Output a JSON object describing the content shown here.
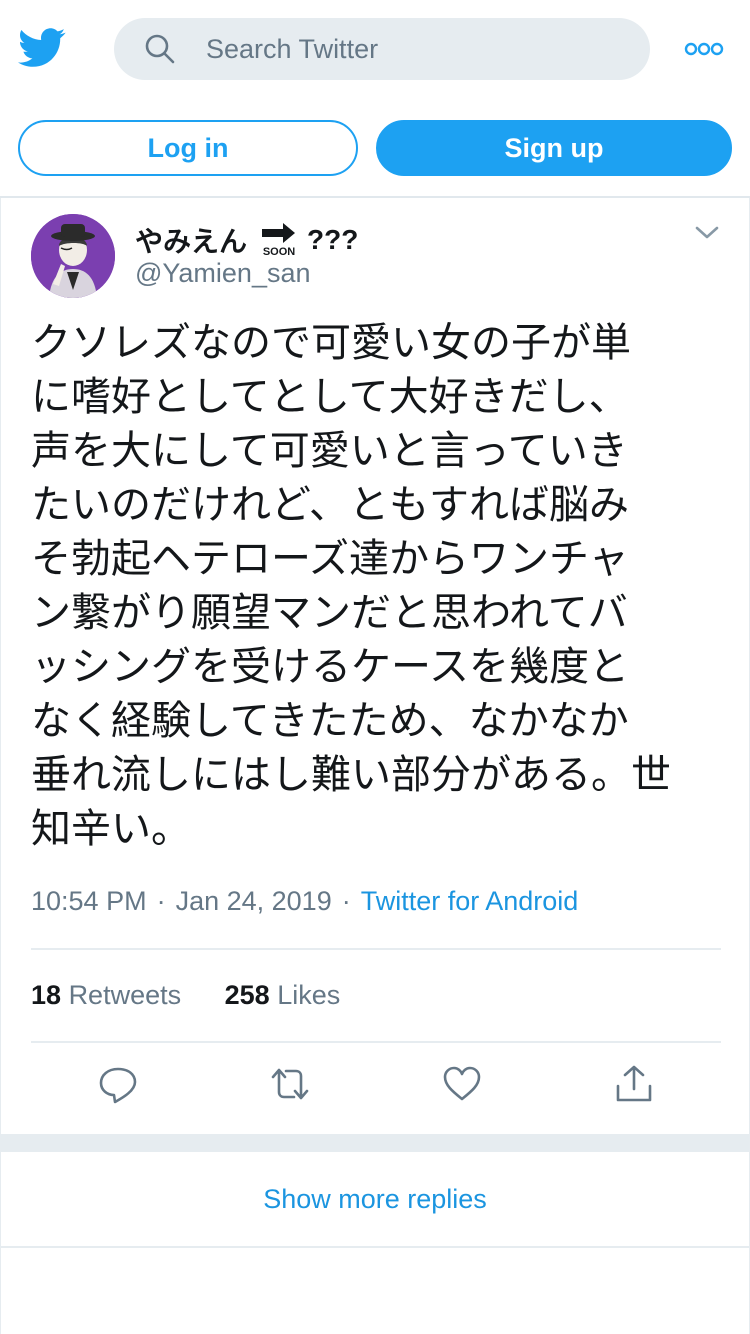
{
  "colors": {
    "brand": "#1da1f2",
    "link": "#1b95e0",
    "muted": "#657786",
    "text": "#14171a",
    "search_bg": "#e6ecf0",
    "avatar_bg": "#7b3fb0"
  },
  "header": {
    "logo_icon": "twitter-bird-icon",
    "search": {
      "placeholder": "Search Twitter",
      "value": "",
      "icon": "search-icon"
    },
    "more_icon": "more-options-icon"
  },
  "auth": {
    "login_label": "Log in",
    "signup_label": "Sign up"
  },
  "tweet": {
    "author": {
      "display_name_prefix": "やみえん",
      "badge_label": "SOON",
      "display_name_suffix": "???",
      "username": "@Yamien_san",
      "avatar_icon": "avatar-illustration"
    },
    "text": "クソレズなので可愛い女の子が単\nに嗜好としてとして大好きだし、\n声を大にして可愛いと言っていき\nたいのだけれど、ともすれば脳み\nそ勃起ヘテローズ達からワンチャ\nン繋がり願望マンだと思われてバ\nッシングを受けるケースを幾度と\nなく経験してきたため、なかなか\n垂れ流しにはし難い部分がある。世\n知辛い。",
    "time": "10:54 PM",
    "separator": "·",
    "date": "Jan 24, 2019",
    "source": "Twitter for Android",
    "retweets_count": "18",
    "retweets_label": "Retweets",
    "likes_count": "258",
    "likes_label": "Likes",
    "actions": [
      "reply-icon",
      "retweet-icon",
      "like-icon",
      "share-icon"
    ]
  },
  "replies": {
    "show_more_label": "Show more replies"
  }
}
